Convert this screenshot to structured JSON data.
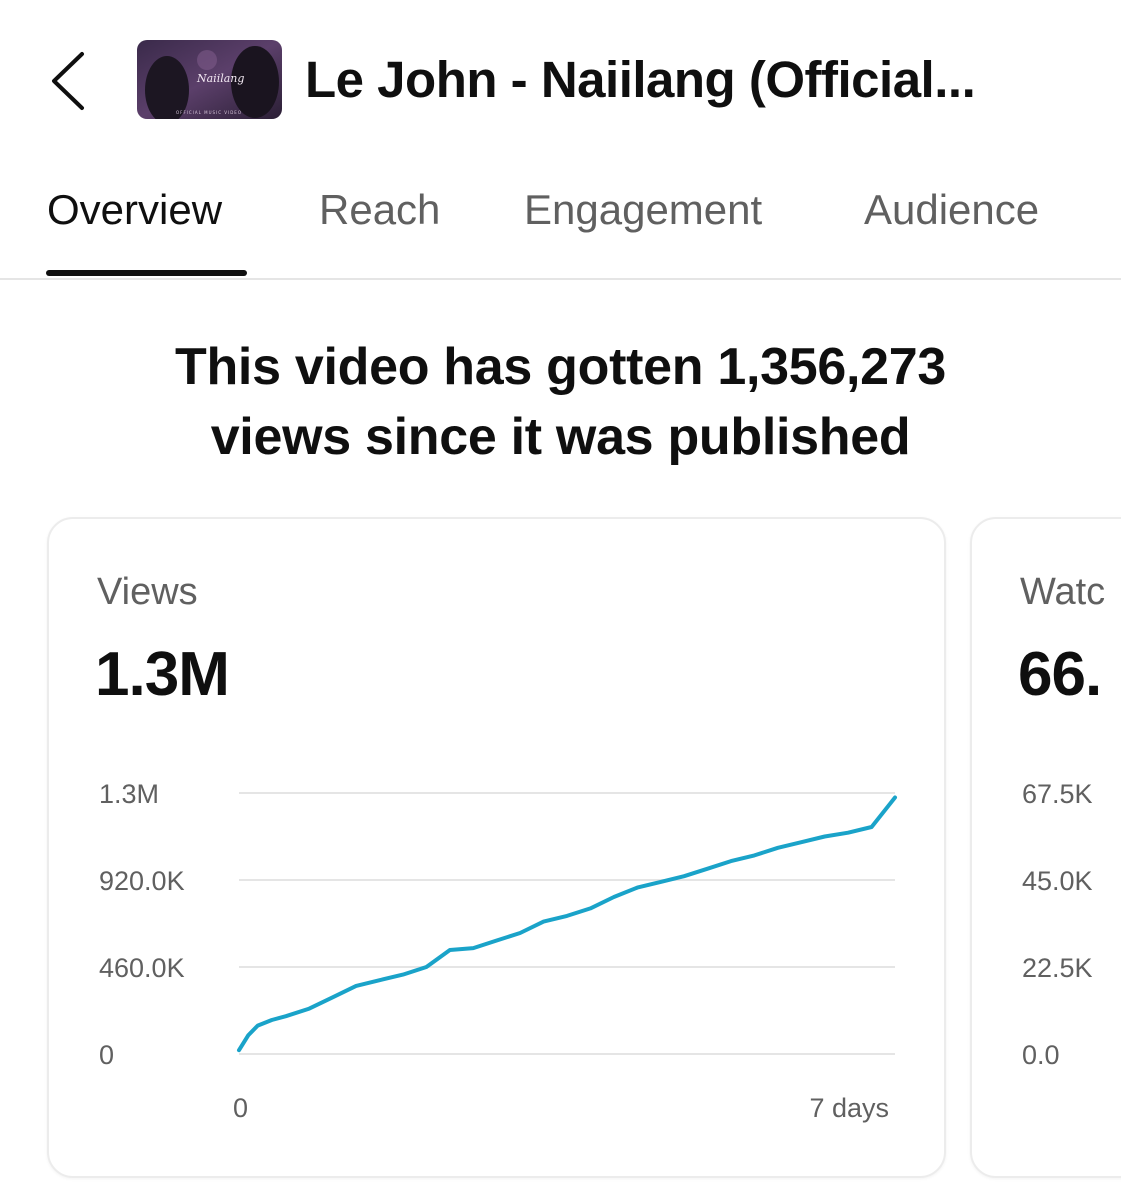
{
  "header": {
    "back_icon": "chevron-left-icon",
    "title": "Le John - Naiilang (Official...",
    "thumbnail": {
      "script_text": "Naiilang",
      "caption_text": "OFFICIAL MUSIC VIDEO"
    }
  },
  "tabs": [
    {
      "label": "Overview",
      "active": true
    },
    {
      "label": "Reach",
      "active": false
    },
    {
      "label": "Engagement",
      "active": false
    },
    {
      "label": "Audience",
      "active": false
    }
  ],
  "summary": {
    "line1": "This video has gotten 1,356,273",
    "line2": "views since it was published"
  },
  "cards": [
    {
      "label": "Views",
      "value": "1.3M"
    },
    {
      "label": "Watc",
      "value": "66."
    }
  ],
  "colors": {
    "line": "#1aa3c9",
    "grid": "#e5e5e5",
    "text_secondary": "#606060"
  },
  "chart_data": [
    {
      "type": "line",
      "title": "",
      "xlabel": "",
      "ylabel": "",
      "x_tick_labels": [
        "0",
        "7 days"
      ],
      "y_tick_labels": [
        "0",
        "460.0K",
        "920.0K",
        "1.3M"
      ],
      "ylim": [
        0,
        1380000
      ],
      "grid": true,
      "series": [
        {
          "x": [
            0,
            0.1,
            0.2,
            0.35,
            0.5,
            0.75,
            1.0,
            1.25,
            1.5,
            1.75,
            2.0,
            2.25,
            2.5,
            2.75,
            3.0,
            3.25,
            3.5,
            3.75,
            4.0,
            4.25,
            4.5,
            4.75,
            5.0,
            5.25,
            5.5,
            5.75,
            6.0,
            6.25,
            6.5,
            6.75,
            7.0
          ],
          "y": [
            20000,
            100000,
            150000,
            180000,
            200000,
            240000,
            300000,
            360000,
            390000,
            420000,
            460000,
            550000,
            560000,
            600000,
            640000,
            700000,
            730000,
            770000,
            830000,
            880000,
            910000,
            940000,
            980000,
            1020000,
            1050000,
            1090000,
            1120000,
            1150000,
            1170000,
            1200000,
            1356273
          ]
        }
      ]
    },
    {
      "type": "line",
      "title": "",
      "xlabel": "",
      "ylabel": "",
      "y_tick_labels": [
        "0.0",
        "22.5K",
        "45.0K",
        "67.5K"
      ],
      "ylim": [
        0,
        67500
      ],
      "grid": true,
      "series": []
    }
  ]
}
